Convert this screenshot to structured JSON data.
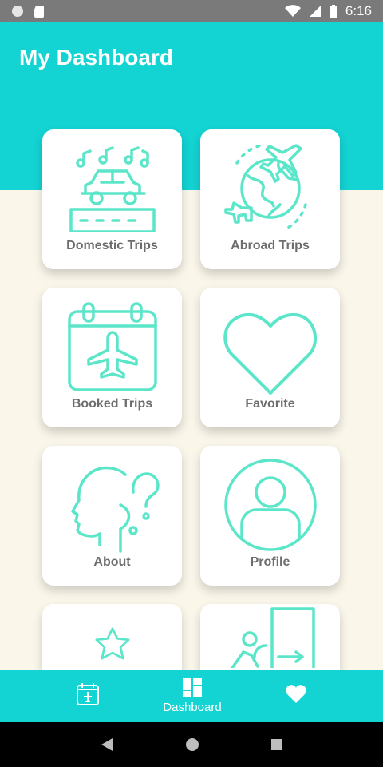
{
  "status_bar": {
    "time": "6:16",
    "icons": [
      "circle-icon",
      "sd-card-icon",
      "wifi-icon",
      "signal-icon",
      "battery-icon"
    ]
  },
  "header": {
    "title": "My Dashboard"
  },
  "colors": {
    "accent": "#14d3d3",
    "background": "#faf6ea",
    "icon_stroke": "#5ce6c9",
    "label": "#6d6d6d"
  },
  "cards": [
    {
      "label": "Domestic Trips",
      "icon": "car-music-icon"
    },
    {
      "label": "Abroad Trips",
      "icon": "globe-planes-icon"
    },
    {
      "label": "Booked Trips",
      "icon": "calendar-plane-icon"
    },
    {
      "label": "Favorite",
      "icon": "heart-icon"
    },
    {
      "label": "About",
      "icon": "head-question-icon"
    },
    {
      "label": "Profile",
      "icon": "user-circle-icon"
    },
    {
      "label": "",
      "icon": "star-icon"
    },
    {
      "label": "",
      "icon": "exit-door-icon"
    }
  ],
  "bottom_nav": {
    "items": [
      {
        "label": "",
        "icon": "calendar-plane-icon"
      },
      {
        "label": "Dashboard",
        "icon": "dashboard-icon"
      },
      {
        "label": "",
        "icon": "heart-icon"
      }
    ]
  },
  "system_nav": [
    "back-icon",
    "home-icon",
    "recents-icon"
  ]
}
